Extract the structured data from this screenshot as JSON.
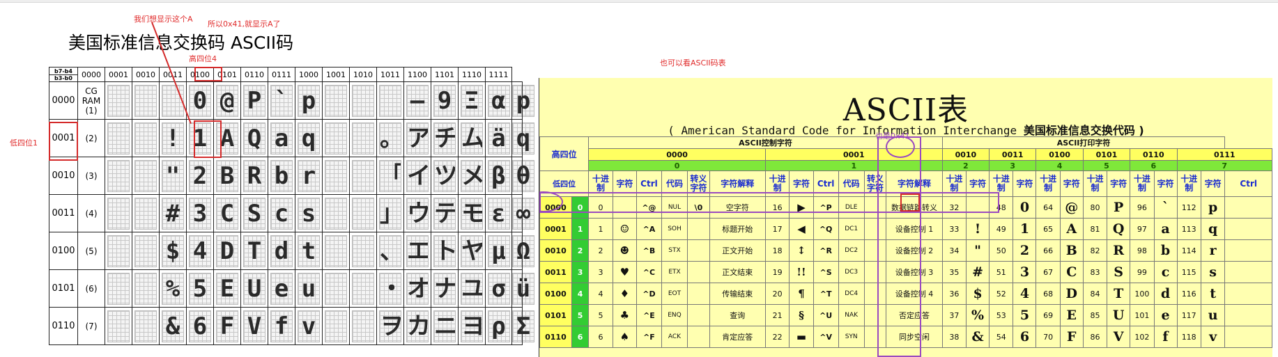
{
  "annotations": {
    "want_show_a": "我们想显示这个A",
    "so_0x41": "所以0x41,就显示A了",
    "high4": "高四位4",
    "low4": "低四位1",
    "also_ascii": "也可以看ASCII码表",
    "also_0x41": "也是0x41"
  },
  "title": "美国标准信息交换码   ASCII码",
  "lcd_table": {
    "corner_top": "b7-b4",
    "corner_bottom": "b3-b0",
    "columns": [
      "0000",
      "0001",
      "0010",
      "0011",
      "0100",
      "0101",
      "0110",
      "0111",
      "1000",
      "1001",
      "1010",
      "1011",
      "1100",
      "1101",
      "1110",
      "1111"
    ],
    "rows": [
      {
        "code": "0000",
        "idx": "CG RAM (1)",
        "chars": [
          "",
          "",
          "",
          "0",
          "@",
          "P",
          "`",
          "p",
          "",
          "",
          "",
          "—",
          "9",
          "Ξ",
          "α",
          "p"
        ]
      },
      {
        "code": "0001",
        "idx": "(2)",
        "chars": [
          "",
          "",
          "!",
          "1",
          "A",
          "Q",
          "a",
          "q",
          "",
          "",
          "。",
          "ア",
          "チ",
          "ム",
          "ä",
          "q"
        ]
      },
      {
        "code": "0010",
        "idx": "(3)",
        "chars": [
          "",
          "",
          "\"",
          "2",
          "B",
          "R",
          "b",
          "r",
          "",
          "",
          "「",
          "イ",
          "ツ",
          "メ",
          "β",
          "θ"
        ]
      },
      {
        "code": "0011",
        "idx": "(4)",
        "chars": [
          "",
          "",
          "#",
          "3",
          "C",
          "S",
          "c",
          "s",
          "",
          "",
          "」",
          "ウ",
          "テ",
          "モ",
          "ε",
          "∞"
        ]
      },
      {
        "code": "0100",
        "idx": "(5)",
        "chars": [
          "",
          "",
          "$",
          "4",
          "D",
          "T",
          "d",
          "t",
          "",
          "",
          "、",
          "エ",
          "ト",
          "ヤ",
          "μ",
          "Ω"
        ]
      },
      {
        "code": "0101",
        "idx": "(6)",
        "chars": [
          "",
          "",
          "%",
          "5",
          "E",
          "U",
          "e",
          "u",
          "",
          "",
          "・",
          "オ",
          "ナ",
          "ユ",
          "σ",
          "ü"
        ]
      },
      {
        "code": "0110",
        "idx": "(7)",
        "chars": [
          "",
          "",
          "&",
          "6",
          "F",
          "V",
          "f",
          "v",
          "",
          "",
          "ヲ",
          "カ",
          "ニ",
          "ヨ",
          "ρ",
          "Σ"
        ]
      }
    ]
  },
  "ascii_chart": {
    "title": "ASCII表",
    "subtitle_en": "( American Standard Code for Information Interchange",
    "subtitle_cn": "美国标准信息交换代码 )",
    "high_label": "高四位",
    "low_label": "低四位",
    "control_group": "ASCII控制字符",
    "print_group": "ASCII打印字符",
    "groups": [
      "0000",
      "0001",
      "0010",
      "0011",
      "0100",
      "0101",
      "0110",
      "0111"
    ],
    "group_digits": [
      "0",
      "1",
      "2",
      "3",
      "4",
      "5",
      "6",
      "7"
    ],
    "col_headers": {
      "dec": "十进制",
      "char": "字符",
      "ctrl": "Ctrl",
      "code": "代码",
      "esc": "转义字符",
      "desc": "字符解释"
    },
    "rows": [
      {
        "low": "0000",
        "d": "0",
        "c0": {
          "dec": "0",
          "ch": "",
          "ctrl": "^@",
          "code": "NUL",
          "esc": "\\0",
          "desc": "空字符"
        },
        "c1": {
          "dec": "16",
          "ch": "▶",
          "ctrl": "^P",
          "code": "DLE",
          "esc": "",
          "desc": "数据链路转义"
        },
        "p": [
          [
            "32",
            ""
          ],
          [
            "48",
            "0"
          ],
          [
            "64",
            "@"
          ],
          [
            "80",
            "P"
          ],
          [
            "96",
            "`"
          ],
          [
            "112",
            "p"
          ]
        ]
      },
      {
        "low": "0001",
        "d": "1",
        "c0": {
          "dec": "1",
          "ch": "☺",
          "ctrl": "^A",
          "code": "SOH",
          "esc": "",
          "desc": "标题开始"
        },
        "c1": {
          "dec": "17",
          "ch": "◀",
          "ctrl": "^Q",
          "code": "DC1",
          "esc": "",
          "desc": "设备控制 1"
        },
        "p": [
          [
            "33",
            "!"
          ],
          [
            "49",
            "1"
          ],
          [
            "65",
            "A"
          ],
          [
            "81",
            "Q"
          ],
          [
            "97",
            "a"
          ],
          [
            "113",
            "q"
          ]
        ]
      },
      {
        "low": "0010",
        "d": "2",
        "c0": {
          "dec": "2",
          "ch": "☻",
          "ctrl": "^B",
          "code": "STX",
          "esc": "",
          "desc": "正文开始"
        },
        "c1": {
          "dec": "18",
          "ch": "↕",
          "ctrl": "^R",
          "code": "DC2",
          "esc": "",
          "desc": "设备控制 2"
        },
        "p": [
          [
            "34",
            "\""
          ],
          [
            "50",
            "2"
          ],
          [
            "66",
            "B"
          ],
          [
            "82",
            "R"
          ],
          [
            "98",
            "b"
          ],
          [
            "114",
            "r"
          ]
        ]
      },
      {
        "low": "0011",
        "d": "3",
        "c0": {
          "dec": "3",
          "ch": "♥",
          "ctrl": "^C",
          "code": "ETX",
          "esc": "",
          "desc": "正文结束"
        },
        "c1": {
          "dec": "19",
          "ch": "!!",
          "ctrl": "^S",
          "code": "DC3",
          "esc": "",
          "desc": "设备控制 3"
        },
        "p": [
          [
            "35",
            "#"
          ],
          [
            "51",
            "3"
          ],
          [
            "67",
            "C"
          ],
          [
            "83",
            "S"
          ],
          [
            "99",
            "c"
          ],
          [
            "115",
            "s"
          ]
        ]
      },
      {
        "low": "0100",
        "d": "4",
        "c0": {
          "dec": "4",
          "ch": "♦",
          "ctrl": "^D",
          "code": "EOT",
          "esc": "",
          "desc": "传输结束"
        },
        "c1": {
          "dec": "20",
          "ch": "¶",
          "ctrl": "^T",
          "code": "DC4",
          "esc": "",
          "desc": "设备控制 4"
        },
        "p": [
          [
            "36",
            "$"
          ],
          [
            "52",
            "4"
          ],
          [
            "68",
            "D"
          ],
          [
            "84",
            "T"
          ],
          [
            "100",
            "d"
          ],
          [
            "116",
            "t"
          ]
        ]
      },
      {
        "low": "0101",
        "d": "5",
        "c0": {
          "dec": "5",
          "ch": "♣",
          "ctrl": "^E",
          "code": "ENQ",
          "esc": "",
          "desc": "查询"
        },
        "c1": {
          "dec": "21",
          "ch": "§",
          "ctrl": "^U",
          "code": "NAK",
          "esc": "",
          "desc": "否定应答"
        },
        "p": [
          [
            "37",
            "%"
          ],
          [
            "53",
            "5"
          ],
          [
            "69",
            "E"
          ],
          [
            "85",
            "U"
          ],
          [
            "101",
            "e"
          ],
          [
            "117",
            "u"
          ]
        ]
      },
      {
        "low": "0110",
        "d": "6",
        "c0": {
          "dec": "6",
          "ch": "♠",
          "ctrl": "^F",
          "code": "ACK",
          "esc": "",
          "desc": "肯定应答"
        },
        "c1": {
          "dec": "22",
          "ch": "▬",
          "ctrl": "^V",
          "code": "SYN",
          "esc": "",
          "desc": "同步空闲"
        },
        "p": [
          [
            "38",
            "&"
          ],
          [
            "54",
            "6"
          ],
          [
            "70",
            "F"
          ],
          [
            "86",
            "V"
          ],
          [
            "102",
            "f"
          ],
          [
            "118",
            "v"
          ]
        ]
      }
    ]
  },
  "colors": {
    "annotation_red": "#e02a2a",
    "annotation_purple": "#9a4ac0",
    "table_bg": "#ffffb0",
    "header_yellow": "#ffff60",
    "header_green": "#7fe83a"
  }
}
